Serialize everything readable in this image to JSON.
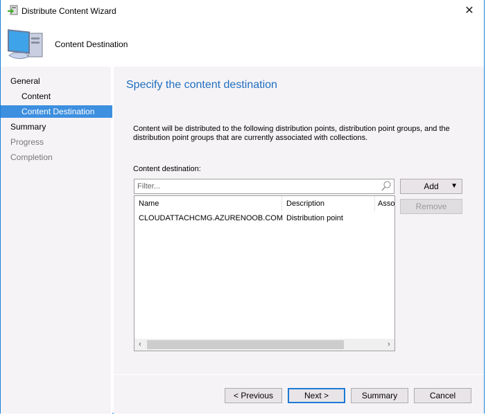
{
  "window": {
    "title": "Distribute Content Wizard",
    "close_icon": "close-icon"
  },
  "header": {
    "title": "Content Destination",
    "icon": "computer-icon"
  },
  "nav": {
    "items": [
      {
        "label": "General",
        "level": 0,
        "state": "normal"
      },
      {
        "label": "Content",
        "level": 1,
        "state": "normal"
      },
      {
        "label": "Content Destination",
        "level": 1,
        "state": "selected"
      },
      {
        "label": "Summary",
        "level": 0,
        "state": "normal"
      },
      {
        "label": "Progress",
        "level": 0,
        "state": "disabled"
      },
      {
        "label": "Completion",
        "level": 0,
        "state": "disabled"
      }
    ]
  },
  "main": {
    "title": "Specify the content destination",
    "description": "Content will be distributed to the following distribution points, distribution point groups, and the distribution point groups that are currently associated with collections.",
    "list_label": "Content destination:",
    "filter_placeholder": "Filter...",
    "columns": [
      "Name",
      "Description",
      "Asso"
    ],
    "rows": [
      {
        "name": "CLOUDATTACHCMG.AZURENOOB.COM",
        "description": "Distribution point",
        "associated": ""
      }
    ],
    "add_label": "Add",
    "remove_label": "Remove"
  },
  "footer": {
    "previous": "< Previous",
    "next": "Next >",
    "summary": "Summary",
    "cancel": "Cancel"
  },
  "colors": {
    "accent": "#1e6fc0",
    "selection": "#3d8fe0",
    "background": "#f6f3f6"
  }
}
